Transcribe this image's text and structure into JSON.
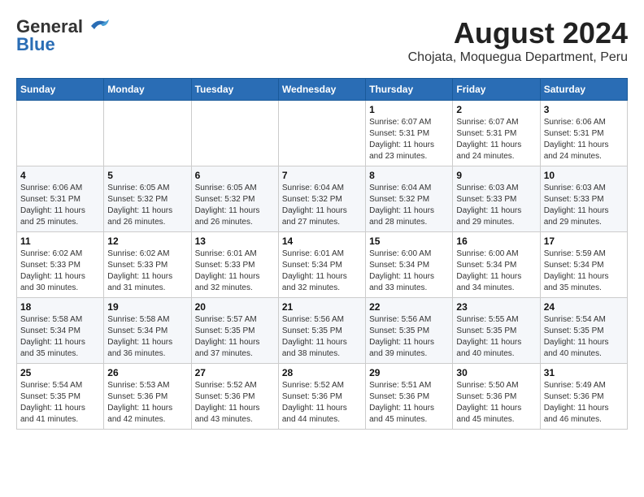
{
  "logo": {
    "general": "General",
    "blue": "Blue"
  },
  "title": "August 2024",
  "subtitle": "Chojata, Moquegua Department, Peru",
  "weekdays": [
    "Sunday",
    "Monday",
    "Tuesday",
    "Wednesday",
    "Thursday",
    "Friday",
    "Saturday"
  ],
  "weeks": [
    [
      {
        "day": "",
        "info": ""
      },
      {
        "day": "",
        "info": ""
      },
      {
        "day": "",
        "info": ""
      },
      {
        "day": "",
        "info": ""
      },
      {
        "day": "1",
        "info": "Sunrise: 6:07 AM\nSunset: 5:31 PM\nDaylight: 11 hours and 23 minutes."
      },
      {
        "day": "2",
        "info": "Sunrise: 6:07 AM\nSunset: 5:31 PM\nDaylight: 11 hours and 24 minutes."
      },
      {
        "day": "3",
        "info": "Sunrise: 6:06 AM\nSunset: 5:31 PM\nDaylight: 11 hours and 24 minutes."
      }
    ],
    [
      {
        "day": "4",
        "info": "Sunrise: 6:06 AM\nSunset: 5:31 PM\nDaylight: 11 hours and 25 minutes."
      },
      {
        "day": "5",
        "info": "Sunrise: 6:05 AM\nSunset: 5:32 PM\nDaylight: 11 hours and 26 minutes."
      },
      {
        "day": "6",
        "info": "Sunrise: 6:05 AM\nSunset: 5:32 PM\nDaylight: 11 hours and 26 minutes."
      },
      {
        "day": "7",
        "info": "Sunrise: 6:04 AM\nSunset: 5:32 PM\nDaylight: 11 hours and 27 minutes."
      },
      {
        "day": "8",
        "info": "Sunrise: 6:04 AM\nSunset: 5:32 PM\nDaylight: 11 hours and 28 minutes."
      },
      {
        "day": "9",
        "info": "Sunrise: 6:03 AM\nSunset: 5:33 PM\nDaylight: 11 hours and 29 minutes."
      },
      {
        "day": "10",
        "info": "Sunrise: 6:03 AM\nSunset: 5:33 PM\nDaylight: 11 hours and 29 minutes."
      }
    ],
    [
      {
        "day": "11",
        "info": "Sunrise: 6:02 AM\nSunset: 5:33 PM\nDaylight: 11 hours and 30 minutes."
      },
      {
        "day": "12",
        "info": "Sunrise: 6:02 AM\nSunset: 5:33 PM\nDaylight: 11 hours and 31 minutes."
      },
      {
        "day": "13",
        "info": "Sunrise: 6:01 AM\nSunset: 5:33 PM\nDaylight: 11 hours and 32 minutes."
      },
      {
        "day": "14",
        "info": "Sunrise: 6:01 AM\nSunset: 5:34 PM\nDaylight: 11 hours and 32 minutes."
      },
      {
        "day": "15",
        "info": "Sunrise: 6:00 AM\nSunset: 5:34 PM\nDaylight: 11 hours and 33 minutes."
      },
      {
        "day": "16",
        "info": "Sunrise: 6:00 AM\nSunset: 5:34 PM\nDaylight: 11 hours and 34 minutes."
      },
      {
        "day": "17",
        "info": "Sunrise: 5:59 AM\nSunset: 5:34 PM\nDaylight: 11 hours and 35 minutes."
      }
    ],
    [
      {
        "day": "18",
        "info": "Sunrise: 5:58 AM\nSunset: 5:34 PM\nDaylight: 11 hours and 35 minutes."
      },
      {
        "day": "19",
        "info": "Sunrise: 5:58 AM\nSunset: 5:34 PM\nDaylight: 11 hours and 36 minutes."
      },
      {
        "day": "20",
        "info": "Sunrise: 5:57 AM\nSunset: 5:35 PM\nDaylight: 11 hours and 37 minutes."
      },
      {
        "day": "21",
        "info": "Sunrise: 5:56 AM\nSunset: 5:35 PM\nDaylight: 11 hours and 38 minutes."
      },
      {
        "day": "22",
        "info": "Sunrise: 5:56 AM\nSunset: 5:35 PM\nDaylight: 11 hours and 39 minutes."
      },
      {
        "day": "23",
        "info": "Sunrise: 5:55 AM\nSunset: 5:35 PM\nDaylight: 11 hours and 40 minutes."
      },
      {
        "day": "24",
        "info": "Sunrise: 5:54 AM\nSunset: 5:35 PM\nDaylight: 11 hours and 40 minutes."
      }
    ],
    [
      {
        "day": "25",
        "info": "Sunrise: 5:54 AM\nSunset: 5:35 PM\nDaylight: 11 hours and 41 minutes."
      },
      {
        "day": "26",
        "info": "Sunrise: 5:53 AM\nSunset: 5:36 PM\nDaylight: 11 hours and 42 minutes."
      },
      {
        "day": "27",
        "info": "Sunrise: 5:52 AM\nSunset: 5:36 PM\nDaylight: 11 hours and 43 minutes."
      },
      {
        "day": "28",
        "info": "Sunrise: 5:52 AM\nSunset: 5:36 PM\nDaylight: 11 hours and 44 minutes."
      },
      {
        "day": "29",
        "info": "Sunrise: 5:51 AM\nSunset: 5:36 PM\nDaylight: 11 hours and 45 minutes."
      },
      {
        "day": "30",
        "info": "Sunrise: 5:50 AM\nSunset: 5:36 PM\nDaylight: 11 hours and 45 minutes."
      },
      {
        "day": "31",
        "info": "Sunrise: 5:49 AM\nSunset: 5:36 PM\nDaylight: 11 hours and 46 minutes."
      }
    ]
  ]
}
